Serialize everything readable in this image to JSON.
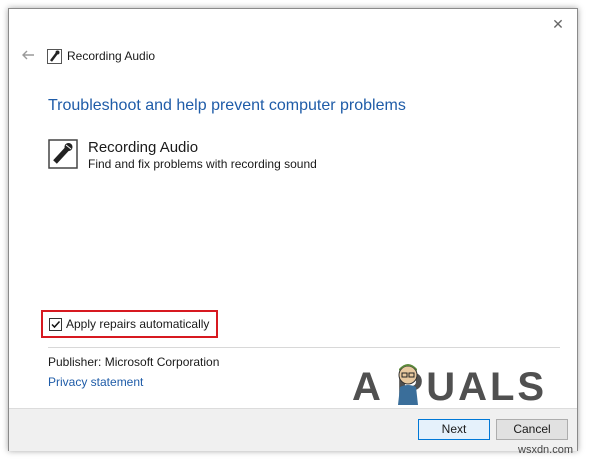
{
  "window": {
    "title": "Recording Audio",
    "close_glyph": "✕"
  },
  "content": {
    "heading": "Troubleshoot and help prevent computer problems",
    "item_title": "Recording Audio",
    "item_description": "Find and fix problems with recording sound"
  },
  "options": {
    "apply_repairs_label": "Apply repairs automatically",
    "apply_repairs_checked": true
  },
  "publisher": {
    "label": "Publisher:  Microsoft Corporation"
  },
  "links": {
    "privacy": "Privacy statement"
  },
  "buttons": {
    "next": "Next",
    "cancel": "Cancel"
  },
  "watermark": {
    "logo_text": "A PUALS",
    "site": "wsxdn.com"
  },
  "colors": {
    "link_blue": "#1f5ca8",
    "highlight_red": "#d71920"
  },
  "icons": {
    "back": "back-arrow-icon",
    "app": "microphone-icon",
    "close": "close-icon"
  }
}
